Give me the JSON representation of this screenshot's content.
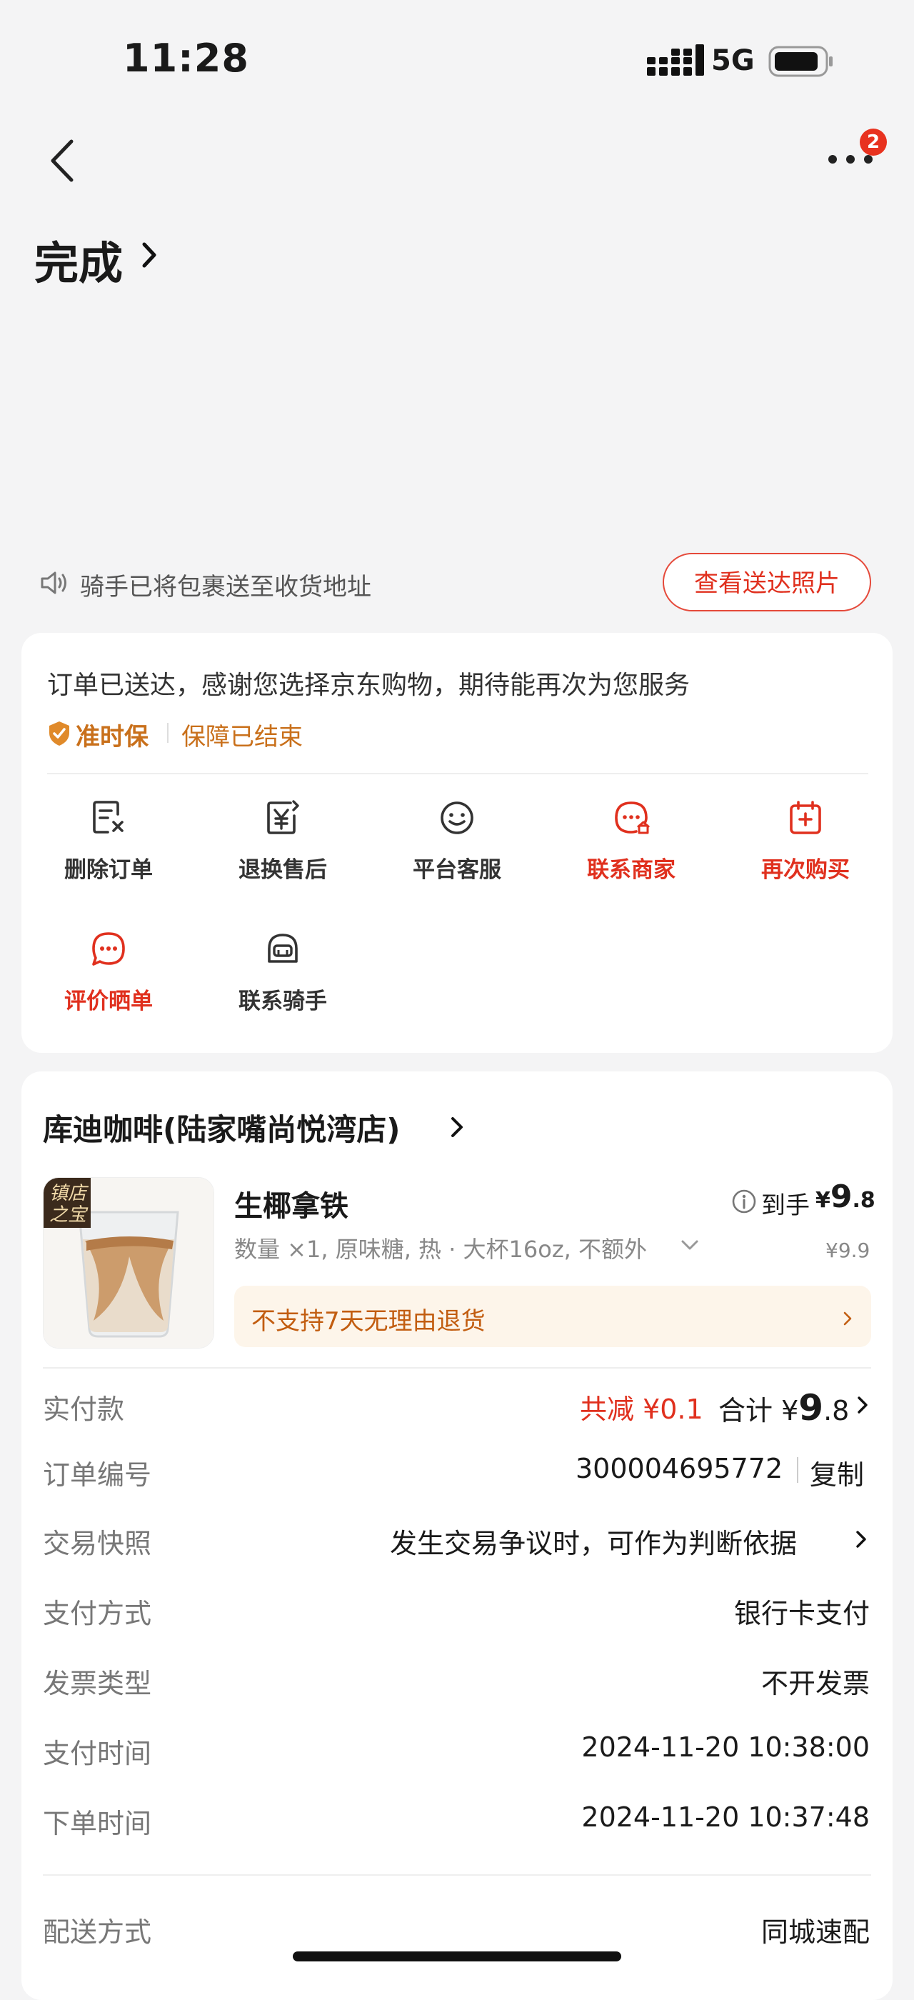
{
  "status_bar": {
    "time": "11:28",
    "network": "5G"
  },
  "nav": {
    "badge_count": "2"
  },
  "order": {
    "status_title": "完成",
    "rider_notice": "骑手已将包裹送至收货地址",
    "view_photo_button": "查看送达照片",
    "thanks_text": "订单已送达，感谢您选择京东购物，期待能再次为您服务",
    "ontime_label": "准时保",
    "guarantee_text": "保障已结束"
  },
  "actions": [
    {
      "label": "删除订单",
      "icon": "delete-order-icon",
      "color": "gray"
    },
    {
      "label": "退换售后",
      "icon": "refund-icon",
      "color": "gray"
    },
    {
      "label": "平台客服",
      "icon": "customer-service-icon",
      "color": "gray"
    },
    {
      "label": "联系商家",
      "icon": "contact-merchant-icon",
      "color": "red"
    },
    {
      "label": "再次购买",
      "icon": "buy-again-icon",
      "color": "red"
    },
    {
      "label": "评价晒单",
      "icon": "review-icon",
      "color": "red"
    },
    {
      "label": "联系骑手",
      "icon": "rider-helmet-icon",
      "color": "gray"
    }
  ],
  "shop": {
    "name": "库迪咖啡(陆家嘴尚悦湾店)",
    "product": {
      "badge": "镇店之宝",
      "name": "生椰拿铁",
      "desc": "数量 ×1, 原味糖, 热 · 大杯16oz, 不额外",
      "final_label": "到手",
      "final_currency": "¥",
      "final_int": "9",
      "final_dec": ".8",
      "original_price": "¥9.9",
      "refund_note": "不支持7天无理由退货"
    }
  },
  "details": {
    "paid_label": "实付款",
    "discount": "共减 ¥0.1",
    "total_label": "合计",
    "total_currency": "¥",
    "total_int": "9",
    "total_dec": ".8",
    "order_no_label": "订单编号",
    "order_no": "300004695772",
    "copy": "复制",
    "snapshot_label": "交易快照",
    "snapshot_value": "发生交易争议时，可作为判断依据",
    "pay_method_label": "支付方式",
    "pay_method": "银行卡支付",
    "invoice_label": "发票类型",
    "invoice": "不开发票",
    "pay_time_label": "支付时间",
    "pay_time": "2024-11-20 10:38:00",
    "order_time_label": "下单时间",
    "order_time": "2024-11-20 10:37:48",
    "delivery_label": "配送方式",
    "delivery": "同城速配"
  },
  "colors": {
    "accent_red": "#e0301e",
    "guarantee_orange": "#c9701b",
    "background": "#f4f4f5"
  }
}
